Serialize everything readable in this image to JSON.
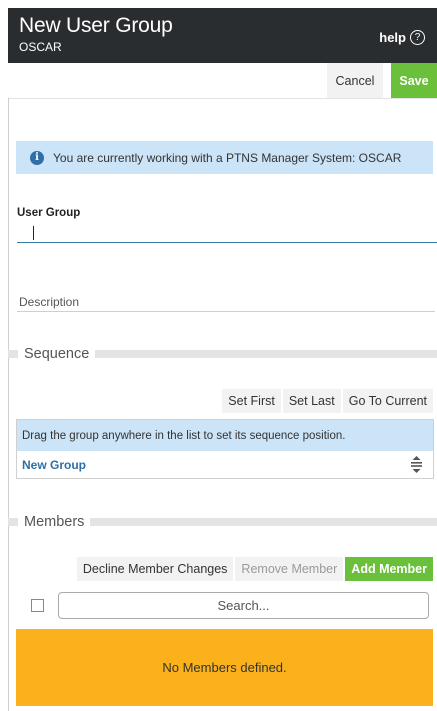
{
  "header": {
    "title": "New User Group",
    "subtitle": "OSCAR",
    "help_label": "help",
    "help_icon": "help-circle-icon"
  },
  "actions": {
    "cancel_label": "Cancel",
    "save_label": "Save"
  },
  "info_banner": {
    "icon": "info-icon",
    "text": "You are currently working with a PTNS Manager System: OSCAR"
  },
  "form": {
    "user_group_label": "User Group",
    "user_group_value": "",
    "description_placeholder": "Description",
    "description_value": ""
  },
  "sequence": {
    "section_label": "Sequence",
    "buttons": {
      "set_first": "Set First",
      "set_last": "Set Last",
      "go_to_current": "Go To Current"
    },
    "hint": "Drag the group anywhere in the list to set its sequence position.",
    "items": [
      {
        "label": "New Group",
        "icon": "drag-handle-icon"
      }
    ]
  },
  "members": {
    "section_label": "Members",
    "buttons": {
      "decline": "Decline Member Changes",
      "remove": "Remove Member",
      "add": "Add Member"
    },
    "search_placeholder": "Search...",
    "empty_message": "No Members defined."
  },
  "colors": {
    "header_bg": "#2a2d2f",
    "accent_green": "#6abf3b",
    "info_bg": "#cce4f7",
    "link_blue": "#2f6fa7",
    "empty_bg": "#fab11b"
  }
}
